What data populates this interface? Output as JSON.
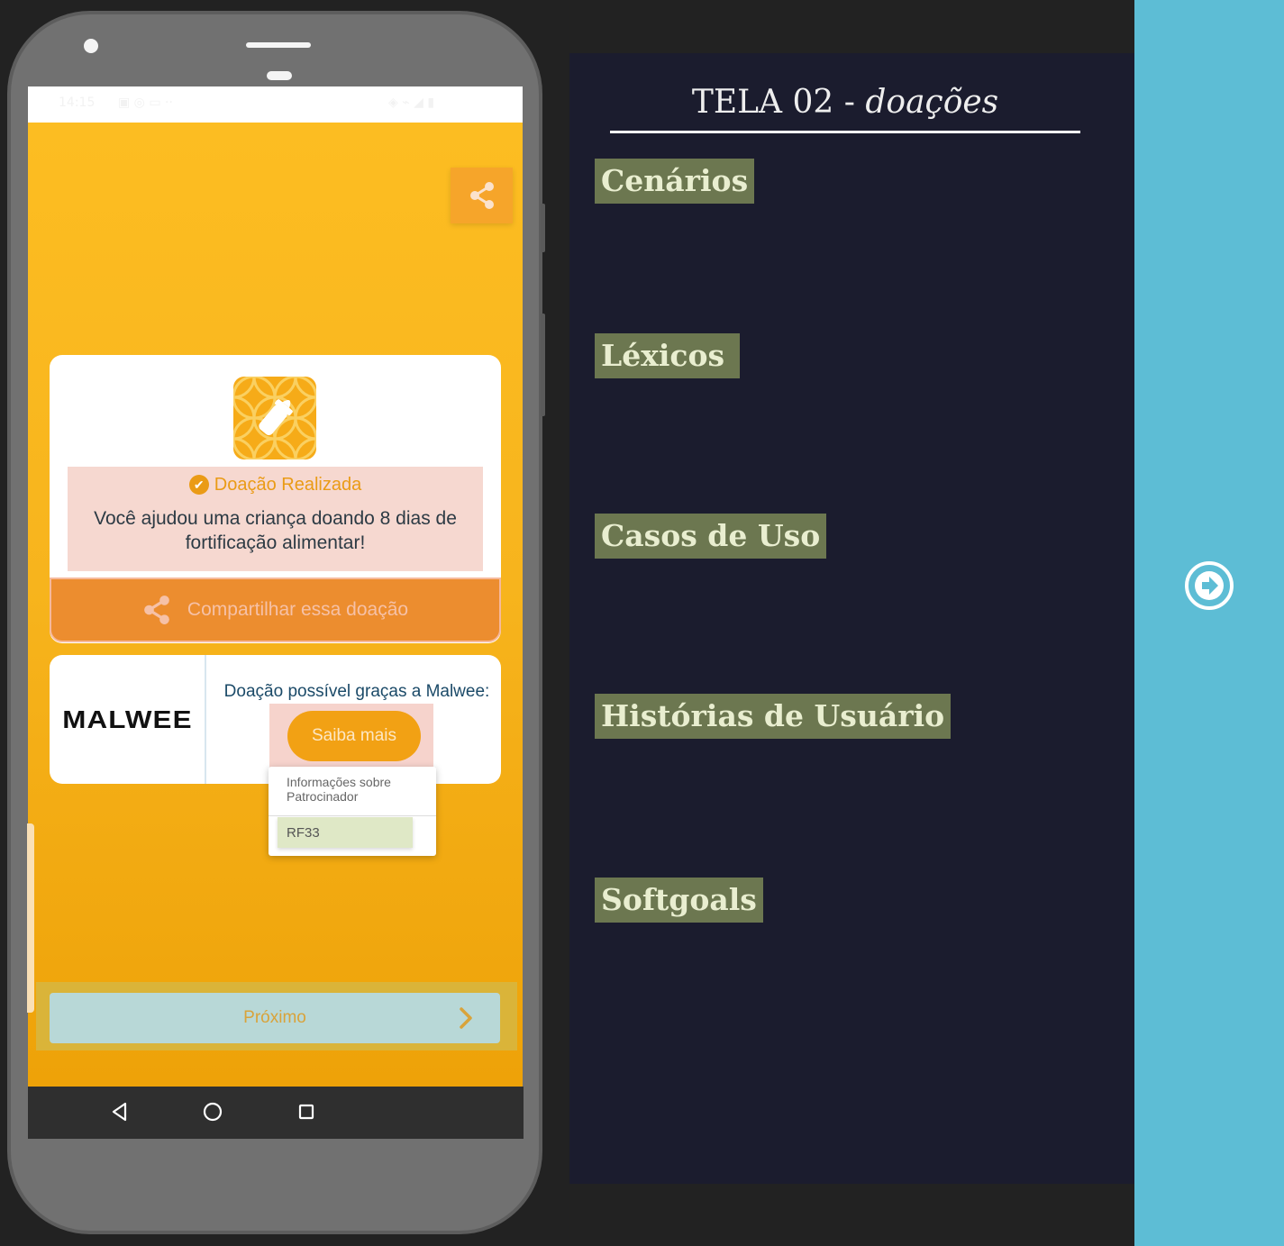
{
  "phone": {
    "status_bar": {
      "time": "14:15",
      "icons": "▣ ◎ ▭ ··",
      "right": "◈ ⌁ ◢ ▮"
    },
    "donation": {
      "status": "Doação Realizada",
      "message": "Você ajudou uma criança doando 8 dias de fortificação alimentar!",
      "share_button": "Compartilhar essa doação"
    },
    "sponsor": {
      "logo_text": "MALWEE",
      "text": "Doação possível graças a Malwee:",
      "button": "Saiba mais"
    },
    "tooltip": {
      "info": "Informações sobre Patrocinador",
      "requirement": "RF33"
    },
    "next_button": "Próximo"
  },
  "slide": {
    "title_main": "TELA 02 - ",
    "title_italic": "doações",
    "tags": [
      "Cenários",
      "Léxicos",
      "Casos de Uso",
      "Histórias de Usuário",
      "Softgoals"
    ]
  },
  "colors": {
    "screen_bg": "#fdbe22",
    "share_button": "#ec8d2f",
    "slide_bg": "#1b1c2e",
    "tag_bg": "#6c7750",
    "side_panel": "#5dbdd5"
  }
}
